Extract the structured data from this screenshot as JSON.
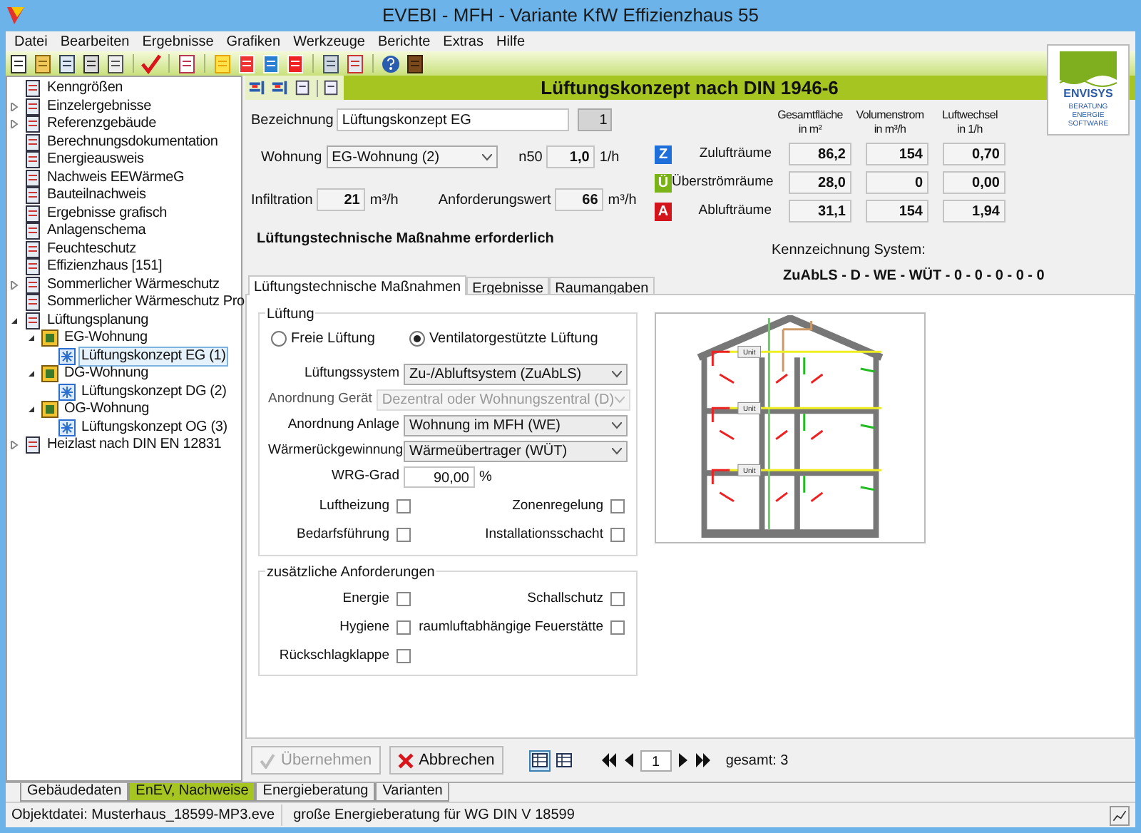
{
  "window": {
    "title": "EVEBI - MFH - Variante KfW Effizienzhaus 55"
  },
  "menu": [
    "Datei",
    "Bearbeiten",
    "Ergebnisse",
    "Grafiken",
    "Werkzeuge",
    "Berichte",
    "Extras",
    "Hilfe"
  ],
  "tree": [
    {
      "label": "Kenngrößen",
      "selected": false
    },
    {
      "label": "Einzelergebnisse",
      "selected": false,
      "expanded": false
    },
    {
      "label": "Referenzgebäude",
      "selected": false,
      "expanded": false
    },
    {
      "label": "Berechnungsdokumentation",
      "selected": false
    },
    {
      "label": "Energieausweis",
      "selected": false
    },
    {
      "label": "Nachweis EEWärmeG",
      "selected": false
    },
    {
      "label": "Bauteilnachweis",
      "selected": false
    },
    {
      "label": "Ergebnisse grafisch",
      "selected": false
    },
    {
      "label": "Anlagenschema",
      "selected": false
    },
    {
      "label": "Feuchteschutz",
      "selected": false
    },
    {
      "label": "Effizienzhaus [151]",
      "selected": false
    },
    {
      "label": "Sommerlicher Wärmeschutz",
      "selected": false,
      "expanded": false
    },
    {
      "label": "Sommerlicher Wärmeschutz Pro",
      "selected": false
    },
    {
      "label": "Lüftungsplanung",
      "selected": false,
      "expanded": true,
      "children": [
        {
          "label": "EG-Wohnung",
          "selected": false,
          "expanded": true,
          "children": [
            {
              "label": "Lüftungskonzept EG (1)",
              "selected": true
            }
          ]
        },
        {
          "label": "DG-Wohnung",
          "selected": false,
          "expanded": true,
          "children": [
            {
              "label": "Lüftungskonzept DG (2)",
              "selected": false
            }
          ]
        },
        {
          "label": "OG-Wohnung",
          "selected": false,
          "expanded": true,
          "children": [
            {
              "label": "Lüftungskonzept OG (3)",
              "selected": false
            }
          ]
        }
      ]
    },
    {
      "label": "Heizlast nach DIN EN 12831",
      "selected": false,
      "expanded": false
    }
  ],
  "header": {
    "title": "Lüftungskonzept nach DIN 1946-6"
  },
  "logo": {
    "name": "ENVISYS",
    "tagline": [
      "BERATUNG",
      "ENERGIE",
      "SOFTWARE"
    ]
  },
  "form": {
    "bezeichnung": {
      "label": "Bezeichnung",
      "value": "Lüftungskonzept EG",
      "number": "1"
    },
    "wohnung": {
      "label": "Wohnung",
      "value": "EG-Wohnung (2)"
    },
    "n50": {
      "label": "n50",
      "value": "1,0",
      "unit": "1/h"
    },
    "infiltration": {
      "label": "Infiltration",
      "value": "21",
      "unit": "m³/h"
    },
    "anforderung": {
      "label": "Anforderungswert",
      "value": "66",
      "unit": "m³/h"
    },
    "message": "Lüftungstechnische Maßnahme erforderlich"
  },
  "summary": {
    "columns": [
      "Gesamtfläche\nin m²",
      "Volumenstrom\nin m³/h",
      "Luftwechsel\nin 1/h"
    ],
    "rows": [
      {
        "badge": "Z",
        "color": "#1e6fd9",
        "label": "Zulufträume",
        "values": [
          "86,2",
          "154",
          "0,70"
        ]
      },
      {
        "badge": "Ü",
        "color": "#7ab317",
        "label": "Überströmräume",
        "values": [
          "28,0",
          "0",
          "0,00"
        ]
      },
      {
        "badge": "A",
        "color": "#d4141c",
        "label": "Ablufträume",
        "values": [
          "31,1",
          "154",
          "1,94"
        ]
      }
    ],
    "system_label": "Kennzeichnung System:",
    "system_code": "ZuAbLS - D - WE - WÜT - 0 - 0 - 0 - 0 - 0"
  },
  "tabs": [
    {
      "label": "Lüftungstechnische Maßnahmen",
      "selected": true
    },
    {
      "label": "Ergebnisse",
      "selected": false
    },
    {
      "label": "Raumangaben",
      "selected": false
    }
  ],
  "lueftung": {
    "title": "Lüftung",
    "radios": [
      {
        "label": "Freie Lüftung",
        "selected": false
      },
      {
        "label": "Ventilatorgestützte Lüftung",
        "selected": true
      }
    ],
    "selects": [
      {
        "label": "Lüftungssystem",
        "value": "Zu-/Abluftsystem (ZuAbLS)",
        "disabled": false
      },
      {
        "label": "Anordnung Gerät",
        "value": "Dezentral oder Wohnungszentral (D)",
        "disabled": true
      },
      {
        "label": "Anordnung Anlage",
        "value": "Wohnung im MFH (WE)",
        "disabled": false
      },
      {
        "label": "Wärmerückgewinnung",
        "value": "Wärmeübertrager (WÜT)",
        "disabled": false
      }
    ],
    "wrg": {
      "label": "WRG-Grad",
      "value": "90,00",
      "unit": "%"
    },
    "checks": [
      {
        "label": "Luftheizung",
        "checked": false
      },
      {
        "label": "Zonenregelung",
        "checked": false
      },
      {
        "label": "Bedarfsführung",
        "checked": false
      },
      {
        "label": "Installationsschacht",
        "checked": false
      }
    ]
  },
  "anforderungen": {
    "title": "zusätzliche Anforderungen",
    "checks": [
      {
        "label": "Energie",
        "checked": false
      },
      {
        "label": "Schallschutz",
        "checked": false
      },
      {
        "label": "Hygiene",
        "checked": false
      },
      {
        "label": "raumluftabhängige Feuerstätte",
        "checked": false
      },
      {
        "label": "Rückschlagklappe",
        "checked": false
      }
    ]
  },
  "diagram": {
    "unit_labels": [
      "Unit",
      "Unit",
      "Unit"
    ]
  },
  "buttons": [
    {
      "label": "Übernehmen",
      "disabled": true,
      "kind": "apply"
    },
    {
      "label": "Abbrechen",
      "disabled": false,
      "kind": "cancel"
    }
  ],
  "view_toggle": [
    {
      "selected": true
    },
    {
      "selected": false
    }
  ],
  "navigator": {
    "record": "1",
    "total": "gesamt: 3"
  },
  "bottom_tabs": [
    {
      "label": "Gebäudedaten",
      "selected": false
    },
    {
      "label": "EnEV, Nachweise",
      "selected": true
    },
    {
      "label": "Energieberatung",
      "selected": false
    },
    {
      "label": "Varianten",
      "selected": false
    }
  ],
  "status_bar": [
    "Objektdatei: Musterhaus_18599-MP3.eve",
    "große Energieberatung für WG DIN V 18599"
  ]
}
